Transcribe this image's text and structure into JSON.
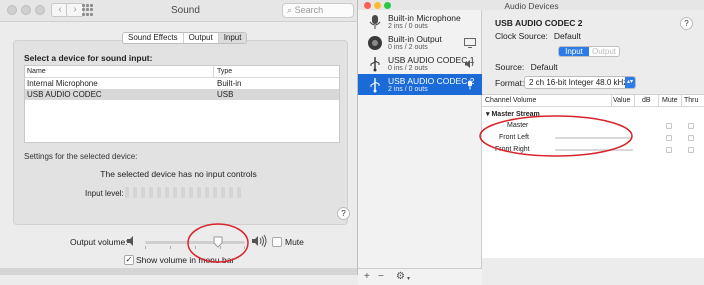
{
  "sound_window": {
    "title": "Sound",
    "search_placeholder": "Search",
    "tabs": [
      {
        "label": "Sound Effects"
      },
      {
        "label": "Output"
      },
      {
        "label": "Input"
      }
    ],
    "selected_tab": "Input",
    "select_device_label": "Select a device for sound input:",
    "table": {
      "columns": [
        "Name",
        "Type"
      ],
      "rows": [
        {
          "name": "Internal Microphone",
          "type": "Built-in"
        },
        {
          "name": "USB AUDIO  CODEC",
          "type": "USB"
        }
      ]
    },
    "settings_label": "Settings for the selected device:",
    "no_controls_text": "The selected device has no input controls",
    "input_level_label": "Input level:",
    "help": "?",
    "output_volume_label": "Output volume:",
    "output_volume_level": 0.73,
    "mute_label": "Mute",
    "mute_checked": false,
    "show_volume_label": "Show volume in menu bar",
    "show_volume_checked": true,
    "checkmark": "✓"
  },
  "audio_devices": {
    "title": "Audio Devices",
    "devices": [
      {
        "name": "Built-in Microphone",
        "io": "2 ins / 0 outs",
        "icon": "microphone-icon"
      },
      {
        "name": "Built-in Output",
        "io": "0 ins / 2 outs",
        "icon": "speaker-icon"
      },
      {
        "name": "USB AUDIO  CODEC 1",
        "io": "0 ins / 2 outs",
        "icon": "usb-icon"
      },
      {
        "name": "USB AUDIO  CODEC 2",
        "io": "2 ins / 0 outs",
        "icon": "usb-icon"
      }
    ],
    "selected_device": "USB AUDIO  CODEC 2",
    "device_name": "USB AUDIO  CODEC 2",
    "clock_source_label": "Clock Source:",
    "clock_source_value": "Default",
    "io_tabs": [
      {
        "label": "Input"
      },
      {
        "label": "Output"
      }
    ],
    "source_label": "Source:",
    "source_value": "Default",
    "format_label": "Format:",
    "format_value": "2 ch 16-bit Integer 48.0 kHz",
    "help": "?",
    "channel_columns": [
      "Channel Volume",
      "Value",
      "dB",
      "Mute",
      "Thru"
    ],
    "master_stream": "Master Stream",
    "channels": [
      "Master",
      "Front Left",
      "Front Right"
    ],
    "bottom_add": "+",
    "bottom_remove": "−",
    "bottom_gear": "⚙"
  },
  "colors": {
    "selection_blue": "#1a6ad8",
    "annotation_red": "#d9232a"
  }
}
